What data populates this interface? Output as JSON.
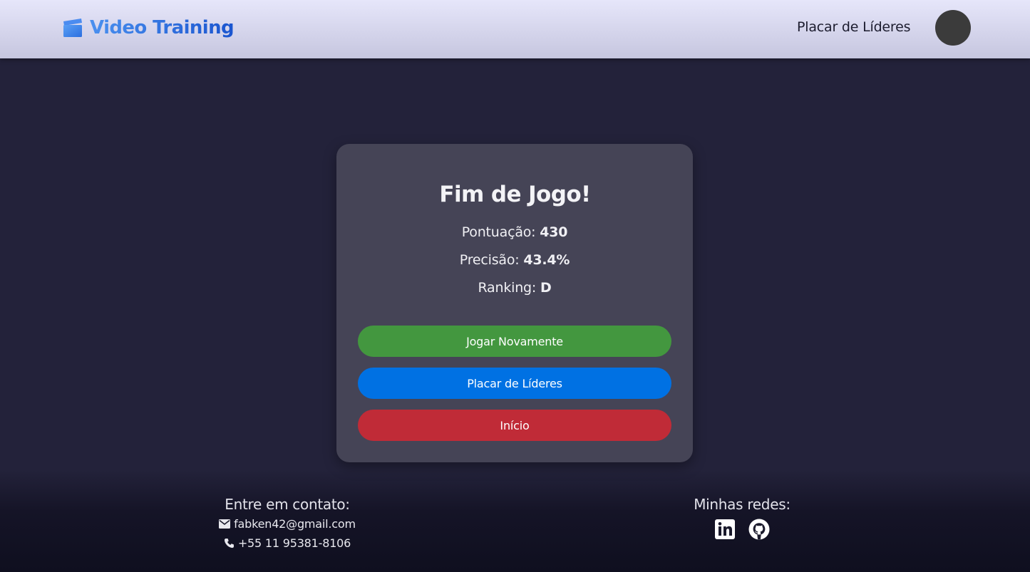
{
  "header": {
    "brand": "Video Training",
    "nav_leaderboard": "Placar de Líderes"
  },
  "result": {
    "title": "Fim de Jogo!",
    "score_label": "Pontuação:",
    "score_value": "430",
    "accuracy_label": "Precisão:",
    "accuracy_value": "43.4%",
    "ranking_label": "Ranking:",
    "ranking_value": "D"
  },
  "buttons": {
    "play_again": "Jogar Novamente",
    "leaderboard": "Placar de Líderes",
    "home": "Início"
  },
  "footer": {
    "contact_heading": "Entre em contato:",
    "email": "fabken42@gmail.com",
    "phone": "+55 11 95381-8106",
    "social_heading": "Minhas redes:",
    "social_icons": [
      "linkedin-icon",
      "github-icon"
    ]
  },
  "colors": {
    "play_again": "#43973f",
    "leaderboard": "#0071e3",
    "home": "#c02b37",
    "card": "#454456",
    "background": "#23223a"
  }
}
